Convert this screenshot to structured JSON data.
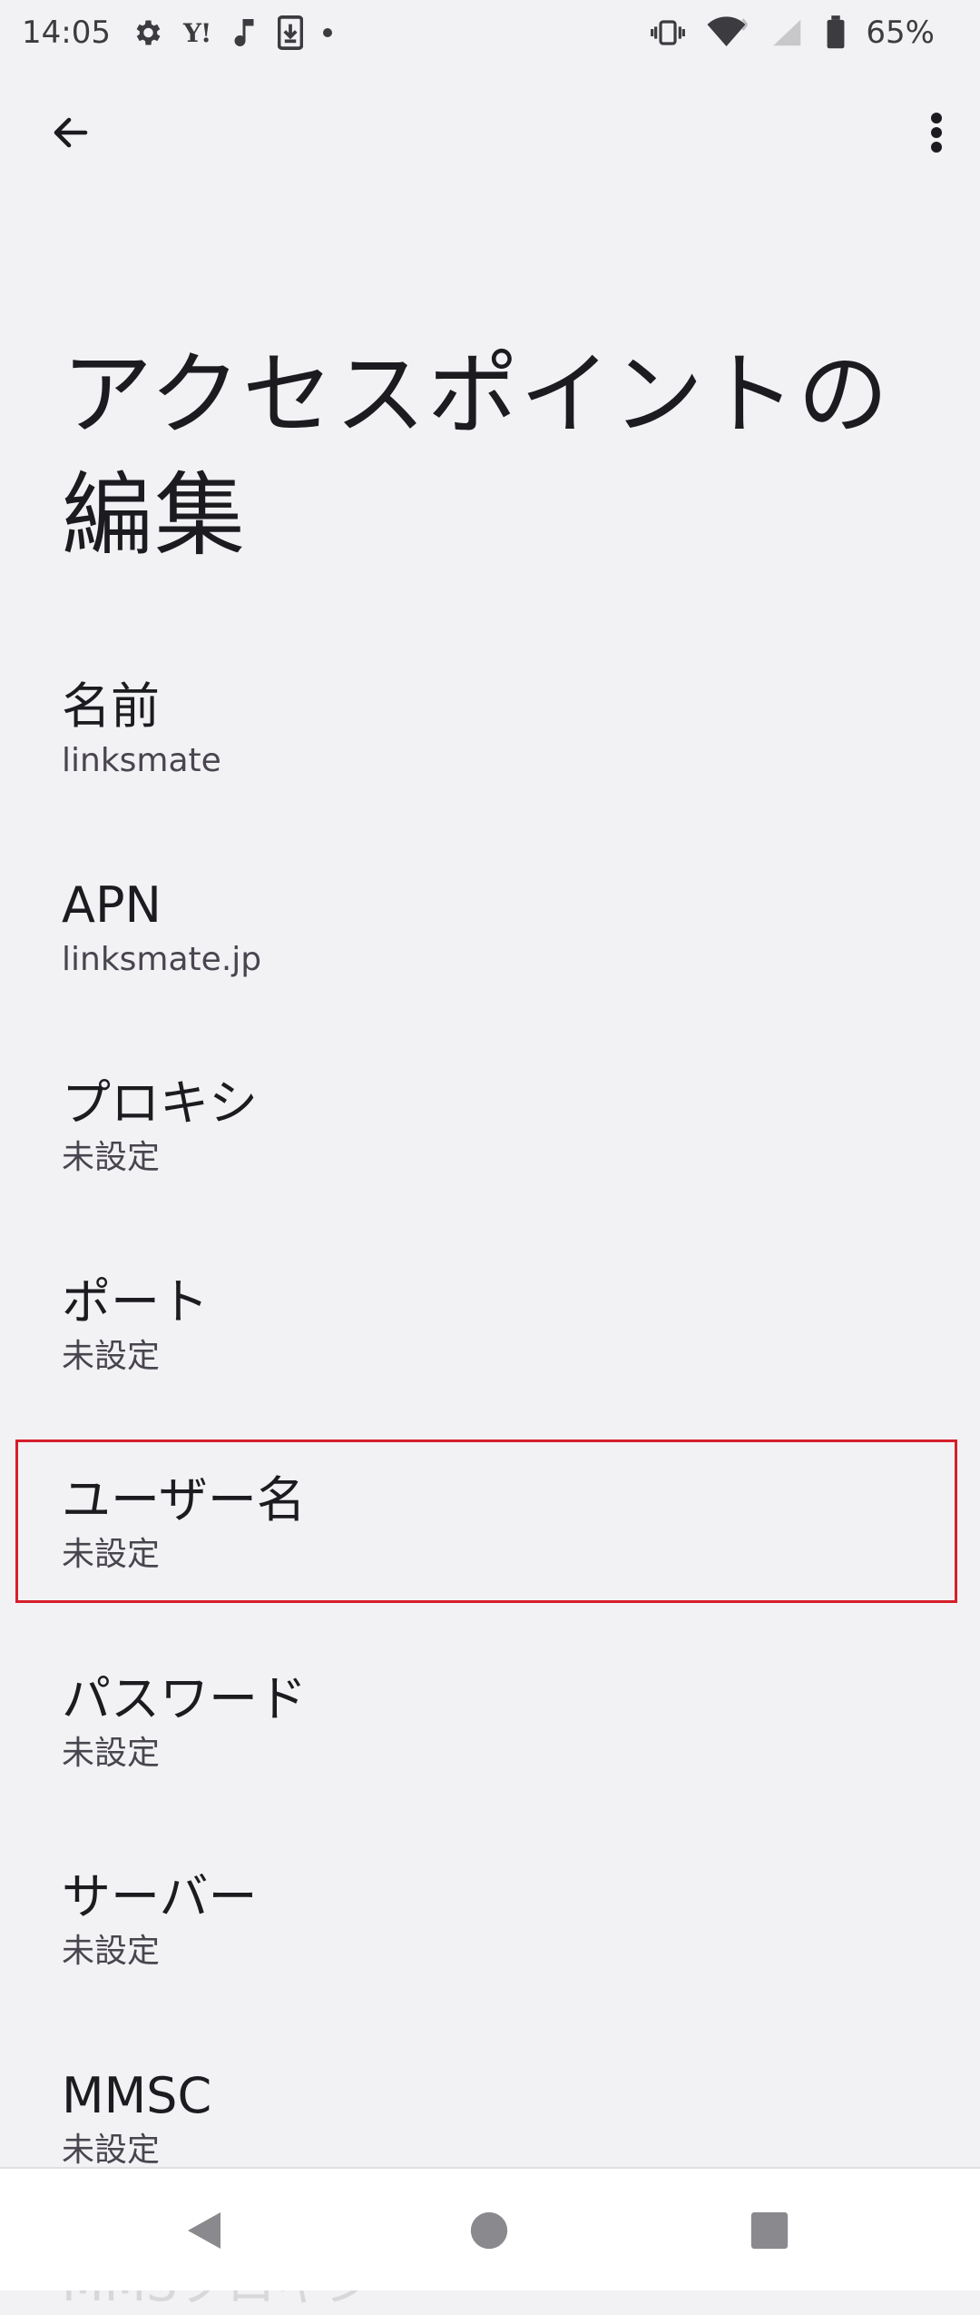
{
  "status_bar": {
    "time": "14:05",
    "yahoo_label": "Y!",
    "battery": "65%",
    "icons_left": [
      "settings-icon",
      "yahoo-icon",
      "music-note-icon",
      "download-icon",
      "dot-icon"
    ],
    "icons_right": [
      "vibrate-icon",
      "wifi-icon",
      "signal-icon",
      "battery-icon"
    ]
  },
  "toolbar": {
    "back_icon": "arrow-left-icon",
    "more_icon": "more-vert-icon"
  },
  "page": {
    "title": "アクセスポイントの編集"
  },
  "prefs": [
    {
      "title": "名前",
      "summary": "linksmate"
    },
    {
      "title": "APN",
      "summary": "linksmate.jp"
    },
    {
      "title": "プロキシ",
      "summary": "未設定"
    },
    {
      "title": "ポート",
      "summary": "未設定"
    },
    {
      "title": "ユーザー名",
      "summary": "未設定"
    },
    {
      "title": "パスワード",
      "summary": "未設定"
    },
    {
      "title": "サーバー",
      "summary": "未設定"
    },
    {
      "title": "MMSC",
      "summary": "未設定"
    }
  ],
  "faded_next_item": "MMSプロキシ",
  "highlight_color": "#d61f2a",
  "nav": {
    "back_icon": "triangle-back-icon",
    "home_icon": "circle-home-icon",
    "recents_icon": "square-recents-icon"
  }
}
